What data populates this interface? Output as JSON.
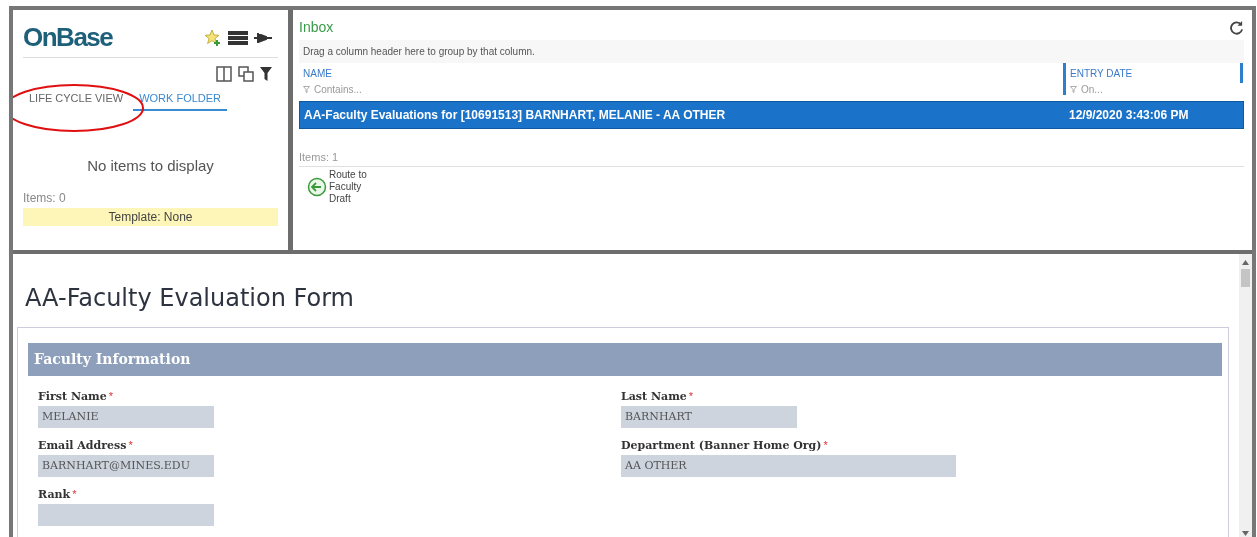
{
  "sidebar": {
    "logo": "OnBase",
    "tabs": [
      {
        "label": "LIFE CYCLE VIEW",
        "selected": false
      },
      {
        "label": "WORK FOLDER",
        "selected": true
      }
    ],
    "empty_message": "No items to display",
    "items_count": "Items: 0",
    "template": "Template: None"
  },
  "inbox": {
    "title": "Inbox",
    "group_hint": "Drag a column header here to group by that column.",
    "columns": [
      {
        "label": "NAME",
        "filter_placeholder": "Contains..."
      },
      {
        "label": "ENTRY DATE",
        "filter_placeholder": "On..."
      }
    ],
    "rows": [
      {
        "name": "AA-Faculty Evaluations for [10691513] BARNHART, MELANIE - AA OTHER",
        "entry_date": "12/9/2020 3:43:06 PM",
        "selected": true
      }
    ],
    "items_count": "Items: 1",
    "task": "Route to Faculty Draft"
  },
  "form": {
    "title": "AA-Faculty Evaluation Form",
    "section": "Faculty Information",
    "fields": [
      {
        "label": "First Name",
        "mark": "*",
        "value": "MELANIE"
      },
      {
        "label": "Last Name",
        "mark": "*",
        "value": "BARNHART"
      },
      {
        "label": "Email Address",
        "mark": "*",
        "value": "BARNHART@MINES.EDU"
      },
      {
        "label": "Department (Banner Home Org)",
        "mark": "*",
        "value": "AA OTHER"
      },
      {
        "label": "Rank",
        "mark": "*"
      }
    ]
  }
}
